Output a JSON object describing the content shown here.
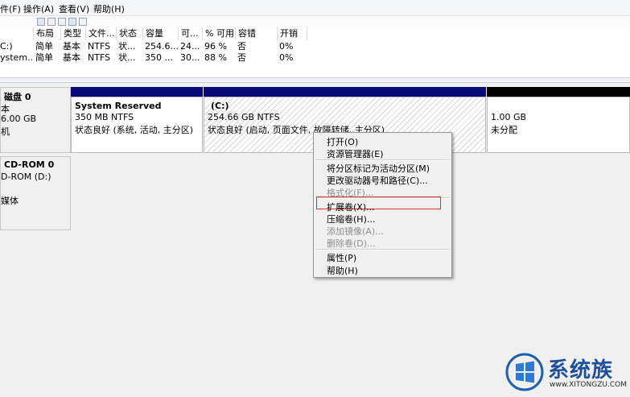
{
  "menubar": {
    "items": [
      "件(F)",
      "操作(A)",
      "查看(V)",
      "帮助(H)"
    ]
  },
  "table": {
    "columns": [
      "布局",
      "类型",
      "文件...",
      "状态",
      "容量",
      "可...",
      "% 可用",
      "容错",
      "开销"
    ],
    "rows": [
      {
        "name": "C:)",
        "layout": "简单",
        "type": "基本",
        "fs": "NTFS",
        "status": "状...",
        "capacity": "254.6...",
        "free": "24...",
        "pct": "96 %",
        "fault": "否",
        "overhead": "0%"
      },
      {
        "name": "ystem...",
        "layout": "简单",
        "type": "基本",
        "fs": "NTFS",
        "status": "状...",
        "capacity": "350 ...",
        "free": "30...",
        "pct": "88 %",
        "fault": "否",
        "overhead": "0%"
      }
    ]
  },
  "disks": {
    "disk0": {
      "title": "磁盘 0",
      "type": "本",
      "size": "6.00 GB",
      "state": "机"
    },
    "cdrom0": {
      "title": "CD-ROM 0",
      "drive": "D-ROM (D:)",
      "media": "媒体"
    }
  },
  "partitions": [
    {
      "name": "System Reserved",
      "size": "350 MB NTFS",
      "status": "状态良好 (系统, 活动, 主分区)"
    },
    {
      "name": "(C:)",
      "size": "254.66 GB NTFS",
      "status": "状态良好 (启动, 页面文件, 故障转储, 主分区)"
    },
    {
      "name": "",
      "size": "1.00 GB",
      "status": "未分配"
    }
  ],
  "context_menu": {
    "items": [
      {
        "label": "打开(O)",
        "enabled": true
      },
      {
        "label": "资源管理器(E)",
        "enabled": true
      },
      {
        "label": "将分区标记为活动分区(M)",
        "enabled": true
      },
      {
        "label": "更改驱动器号和路径(C)...",
        "enabled": true
      },
      {
        "label": "格式化(F)...",
        "enabled": false
      },
      {
        "label": "扩展卷(X)...",
        "enabled": true,
        "highlighted": true
      },
      {
        "label": "压缩卷(H)...",
        "enabled": true
      },
      {
        "label": "添加镜像(A)...",
        "enabled": false
      },
      {
        "label": "删除卷(D)...",
        "enabled": false
      },
      {
        "label": "属性(P)",
        "enabled": true
      },
      {
        "label": "帮助(H)",
        "enabled": true
      }
    ]
  },
  "watermark": {
    "brand": "系统族",
    "url": "www.XITONGZU.COM"
  },
  "colors": {
    "primary_bar": "#0a0a7a",
    "unallocated_bar": "#000000",
    "highlight_border": "#dd3333"
  }
}
